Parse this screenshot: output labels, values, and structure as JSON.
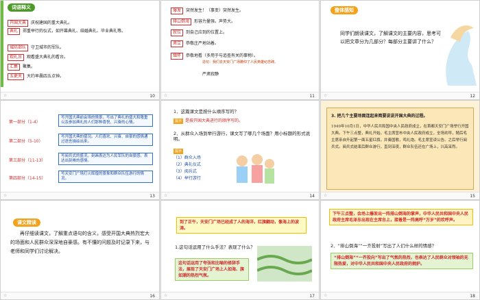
{
  "slides": [
    {
      "number": "10",
      "title": "词语释义",
      "items": [
        {
          "term": "开国大典",
          "def": "庆祝建国的重大典礼。"
        },
        {
          "term": "典礼",
          "def": "郑重举行的仪式，如开幕典礼、结婚典礼、毕业典礼等。"
        },
        {
          "term": "城防部队",
          "def": "守卫城市的军队。"
        },
        {
          "term": "观礼台",
          "def": "观看盛大典礼的看台。"
        },
        {
          "term": "汇集",
          "def": "聚集。"
        },
        {
          "term": "五更天",
          "def": "大约早晨四五点钟。"
        }
      ]
    },
    {
      "number": "11",
      "items": [
        {
          "term": "爆发",
          "def": "突然发生！（事变）突然发生。"
        },
        {
          "term": "排山倒海",
          "def": "形容力量强，声势大。"
        },
        {
          "term": "就位",
          "def": "到自己应到的位置上。"
        },
        {
          "term": "肃立",
          "def": "恭敬庄严地站着。"
        },
        {
          "term": "缅怀",
          "def": "恭敬地看（多用于与追查有关的事物）。",
          "sub": "造句：我们去天安门广场瞻仰了人民英雄纪念碑。"
        },
        {
          "term": "",
          "def": "严肃寂静"
        }
      ]
    },
    {
      "number": "12",
      "title": "整体感知",
      "text": "同学们朗读课文，了解课文的主要内容，思考可以把文章分为几部分？每部分主要讲了什么？"
    },
    {
      "number": "13",
      "parts": [
        {
          "label": "第一部分（1-4）",
          "text": "写开国大典前会场的情景，写出了典礼的盛大和隆重以及参加典礼的人们那种喜悦、兴奋的心情。"
        },
        {
          "label": "第二部分（5-10）",
          "text": "写开国大典的盛况。人们喜欢、兴奋、自豪的感情通过语言描绘出来。"
        },
        {
          "label": "第三部分（11-13）",
          "text": "写阅兵式的盛况。刻画表达为人民军队的自豪感、表达出刻骨的感情。"
        },
        {
          "label": "第四部分（14-15）",
          "text": "写天安门广场灯火辉煌的景象和群众队伍游行的情况。"
        }
      ]
    },
    {
      "number": "14",
      "q1": "1．这篇课文是按什么顺序写的？",
      "hint1": "提示",
      "a1": "是按开国大典进行的顺序写的。",
      "q2": "2．从群众入场到举行游行，课文写了哪几个场面？用小标题的形式说明。",
      "list": [
        "（1）群众入场",
        "（2）典礼仪式",
        "（3）阅兵式",
        "（4）举行游行"
      ]
    },
    {
      "number": "15",
      "heading": "3. 把几个主要场面连起来简要说说开国大典的过程。",
      "text": "1949年10月1日，中华人民共和国中央人民政府成立，在首都天安门广场举行开国大典。下午三点整，典礼开始。毛主席宣布中央人民政府成立，全场欢呼，随后毛主席亲自升起第一面五星红旗，并奏国歌，鸣礼炮。毛主席宣读公告。之后举行阅兵式。阅兵式结束后群众游行，直到深夜，群众队伍还在广场上，兴高采烈。"
    },
    {
      "number": "16",
      "title": "课文精读",
      "text": "再仔细读课文，了解重点语句的含义，感受开国大典热烈宏大的场面和人民群众深深地自豪感。有不懂的问题及时记录下来，与老师和同学们讨论解决。"
    },
    {
      "number": "17",
      "quote": "到了正午，天安门广场已经成了人的海洋，红旗翻动，像海上的波涛。",
      "q": "1.这句话运用了什么手法？表现了什么？",
      "a": "这句话运用了夸张和比喻的修辞手法，展现了天安门广场上人如海、旗如潮的热烈气氛。"
    },
    {
      "number": "18",
      "quote": "下午三点整，会场上爆发出一阵排山倒海的掌声，中华人民共和国中央人民政府主席毛泽东出现在主席台上，接着是一阵高呼“万岁”的欢呼声。",
      "q": "2．“排山倒海”“一齐投射”写出了人们什么样的情感？",
      "a": "“排山倒海”“一齐投向”写出了气氛的热烈，也表达了人民群众对领袖的无限热爱，对中华人民共和国中央人民政府的拥护。"
    }
  ]
}
